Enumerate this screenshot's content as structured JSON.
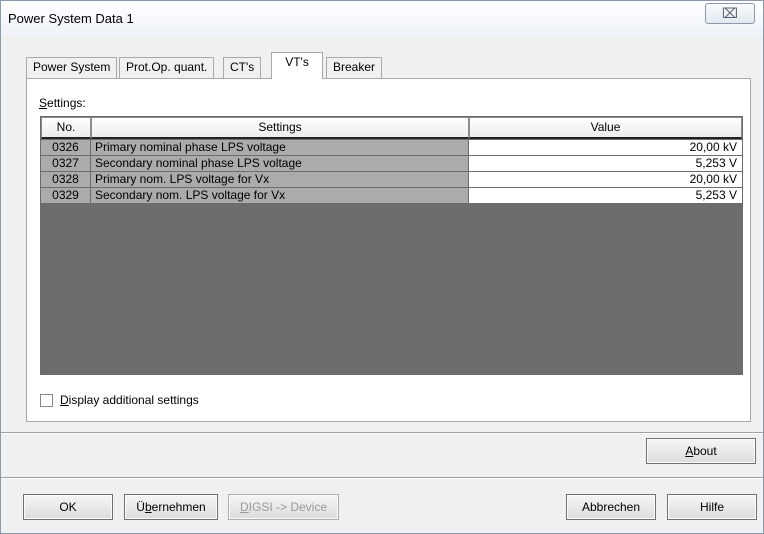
{
  "window": {
    "title": "Power System Data 1",
    "close_glyph": "⌧"
  },
  "tabs": [
    {
      "label": "Power System"
    },
    {
      "label": "Prot.Op. quant."
    },
    {
      "label": "CT's"
    },
    {
      "label": "VT's",
      "active": true
    },
    {
      "label": "Breaker"
    }
  ],
  "settings": {
    "label_accel": "S",
    "label_rest": "ettings:",
    "columns": {
      "no": "No.",
      "settings": "Settings",
      "value": "Value"
    },
    "rows": [
      {
        "no": "0326",
        "setting": "Primary nominal phase LPS voltage",
        "value": "20,00 kV"
      },
      {
        "no": "0327",
        "setting": "Secondary nominal phase LPS voltage",
        "value": "5,253 V"
      },
      {
        "no": "0328",
        "setting": "Primary nom. LPS voltage for Vx",
        "value": "20,00 kV"
      },
      {
        "no": "0329",
        "setting": "Secondary nom. LPS voltage for Vx",
        "value": "5,253 V"
      }
    ]
  },
  "display_additional": {
    "accel": "D",
    "rest": "isplay additional settings",
    "checked": false
  },
  "buttons": {
    "about": {
      "accel": "A",
      "rest": "bout"
    },
    "ok": "OK",
    "apply": {
      "pre": "Ü",
      "accel": "b",
      "rest": "ernehmen"
    },
    "digsi": {
      "accel": "D",
      "rest": "IGSI -> Device",
      "disabled": true
    },
    "cancel": "Abbrechen",
    "help": "Hilfe"
  },
  "colors": {
    "grid_background": "#6d6d6d",
    "readonly_cell": "#ababab",
    "value_cell": "#ffffff"
  }
}
